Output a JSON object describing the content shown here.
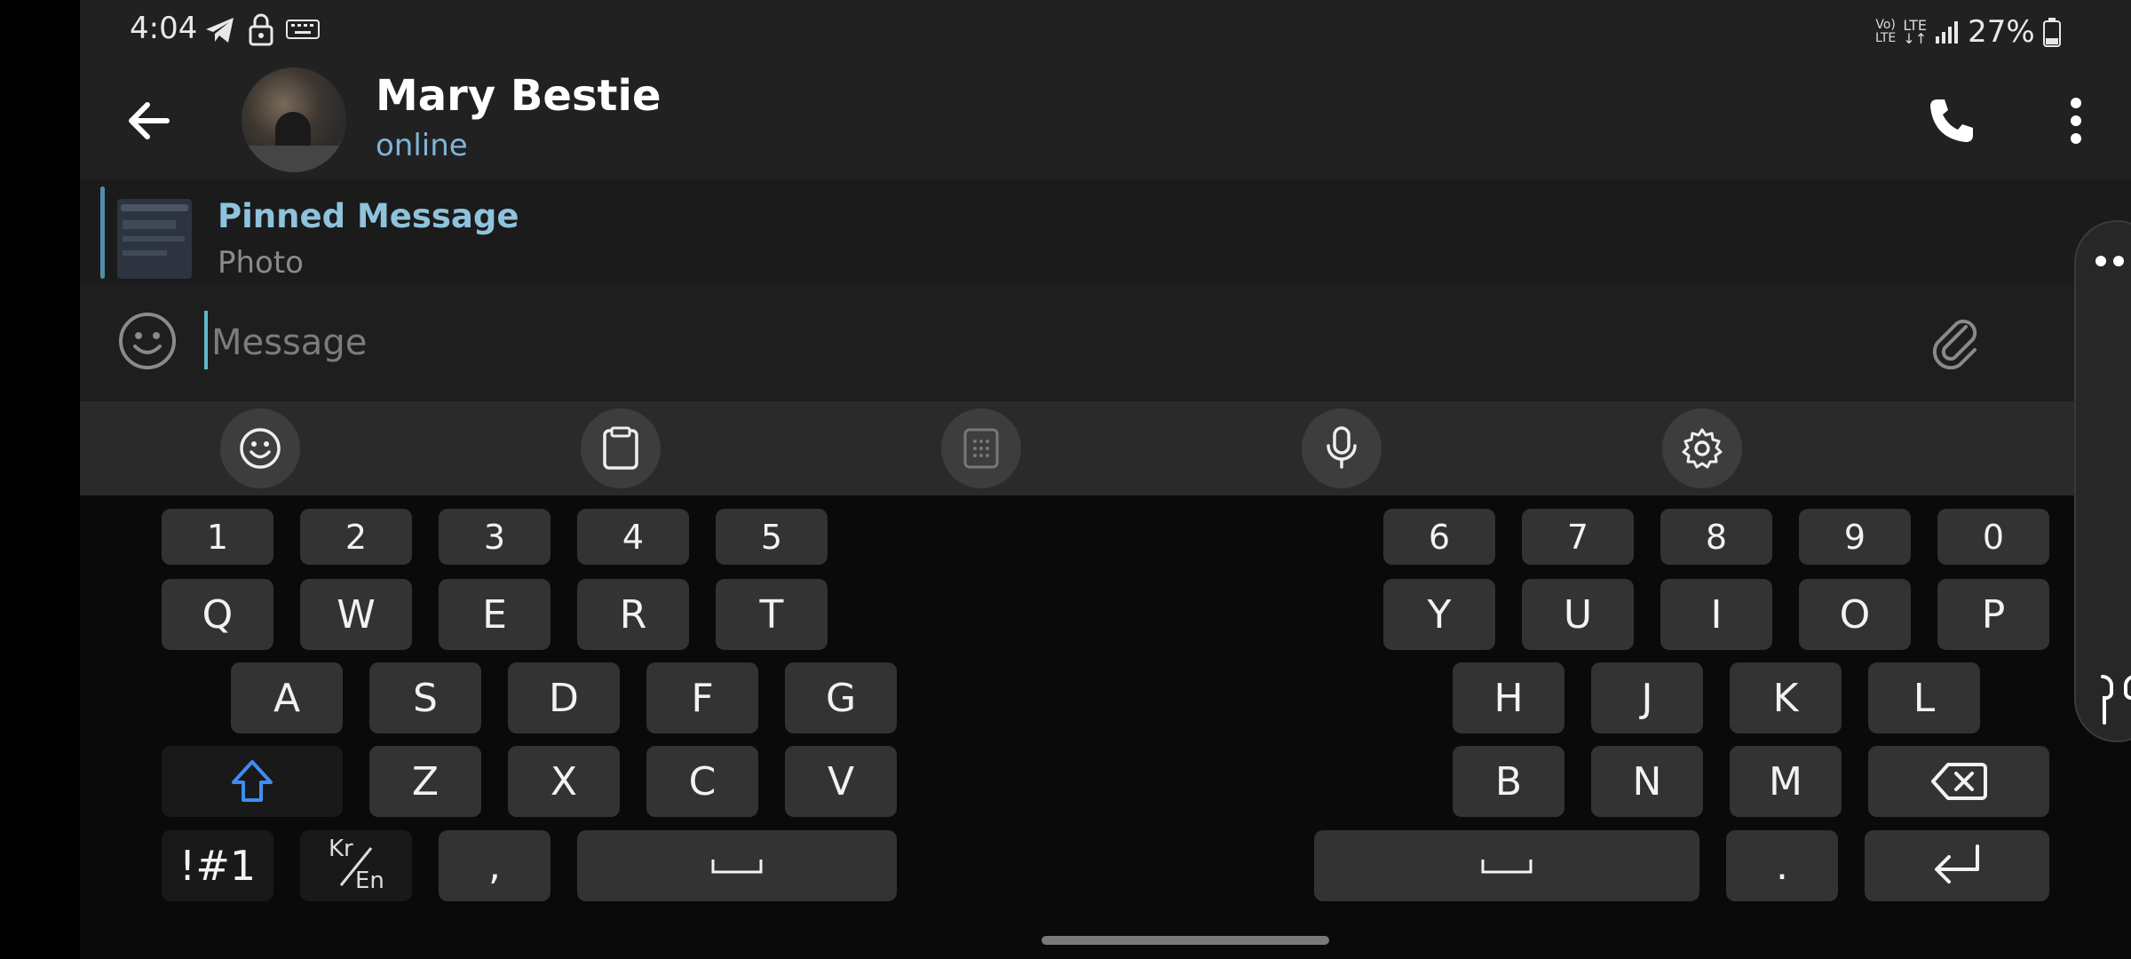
{
  "status_bar": {
    "time": "4:04",
    "net_1_top": "Vo)",
    "net_1_bottom": "LTE",
    "net_2_top": "LTE",
    "net_2_bottom": "↓↑",
    "battery": "27%"
  },
  "chat_header": {
    "name": "Mary Bestie",
    "status": "online"
  },
  "pinned": {
    "title": "Pinned Message",
    "subtitle": "Photo"
  },
  "composer": {
    "placeholder": "Message"
  },
  "keyboard": {
    "numbers_left": [
      "1",
      "2",
      "3",
      "4",
      "5"
    ],
    "numbers_right": [
      "6",
      "7",
      "8",
      "9",
      "0"
    ],
    "row1_left": [
      "Q",
      "W",
      "E",
      "R",
      "T"
    ],
    "row1_right": [
      "Y",
      "U",
      "I",
      "O",
      "P"
    ],
    "row2_left": [
      "A",
      "S",
      "D",
      "F",
      "G"
    ],
    "row2_right": [
      "H",
      "J",
      "K",
      "L"
    ],
    "row3_left": [
      "Z",
      "X",
      "C",
      "V"
    ],
    "row3_right": [
      "B",
      "N",
      "M"
    ],
    "symbols_label": "!#1",
    "lang_top": "Kr",
    "lang_bottom": "En",
    "comma": ",",
    "period": "."
  },
  "colors": {
    "accent": "#8ec3dc",
    "shift": "#3d8ef0",
    "header_bg": "#212121",
    "keyboard_bg": "#0a0a0a",
    "key_bg": "#333333"
  }
}
